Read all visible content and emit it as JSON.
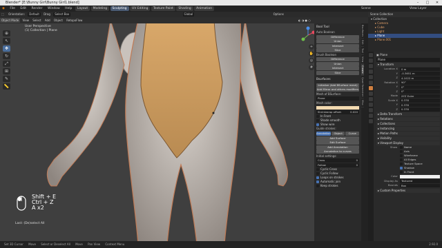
{
  "window": {
    "title": "Blender* [E:\\Bunny Girl\\Bunny Girl1.blend]"
  },
  "menubar": {
    "items": [
      "File",
      "Edit",
      "Render",
      "Window",
      "Help"
    ],
    "workspaces": [
      "Layout",
      "Modeling",
      "Sculpting",
      "UV Editing",
      "Texture Paint",
      "Shading",
      "Animation"
    ],
    "active_workspace": "Sculpting",
    "scene": "Scene",
    "view_layer": "View Layer"
  },
  "toolheader": {
    "orientation_label": "Orientation:",
    "orientation_value": "Default",
    "drag_label": "Drag",
    "drag_value": "Select Box",
    "global": "Global",
    "options": "Options"
  },
  "viewport_header": {
    "mode": "Object Mode",
    "view": "View",
    "select": "Select",
    "add": "Add",
    "object": "Object",
    "retopo": "RetopoFlow"
  },
  "viewport": {
    "perspective": "User Perspective",
    "collection_info": "(1) Collection | Plane"
  },
  "npanel": {
    "bool_tool": "Bool Tool",
    "auto_boolean": "Auto Boolean",
    "auto_buttons": [
      "Difference",
      "Union",
      "Intersect",
      "Slice"
    ],
    "brush_boolean": "Brush Boolean",
    "brush_buttons": [
      "Difference",
      "Union",
      "Intersect",
      "Slice"
    ],
    "bsurfaces": "Bsurfaces",
    "initialize": "Initialize (Add BSurface mesh)",
    "add_mirror": "Add Mirror and others modifiers",
    "mesh_label": "Mesh of BSurface:",
    "mesh_value": "Plane",
    "mesh_color": "Mesh color:",
    "shrinkwrap_label": "Shrinkwrap offset:",
    "shrinkwrap_value": "0.020",
    "in_front": "In Front",
    "shade_smooth": "Shade smooth",
    "show_wire": "Show wire",
    "guide_strokes": "Guide strokes:",
    "guide_tabs": [
      "Annotation",
      "Object",
      "Curve"
    ],
    "add_surface": "Add Surface",
    "edit_surface": "Edit Surface",
    "add_annotation": "Add Annotation",
    "annotation_to_curves": "Annotation to curves",
    "initial_settings": "Initial settings:",
    "cross_label": "Cross",
    "cross_value": "0",
    "follow_label": "Follow",
    "follow_value": "0",
    "cyclic_cross": "Cyclic Cross",
    "cyclic_follow": "Cyclic Follow",
    "loops_on_strokes": "Loops on strokes",
    "automatic_join": "Automatic join",
    "keep_strokes": "Keep strokes",
    "tabs": [
      "Bsurfaces",
      "Edit",
      "Tool",
      "View",
      "Create",
      "Quad Remesher",
      "Misc"
    ]
  },
  "outliner": {
    "title": "Scene Collection",
    "rows": [
      {
        "label": "Collection"
      },
      {
        "label": "Camera"
      },
      {
        "label": "Cube"
      },
      {
        "label": "Light"
      },
      {
        "label": "Plane"
      },
      {
        "label": "Plane.001"
      }
    ]
  },
  "properties": {
    "object_name": "Plane",
    "data_name": "Plane",
    "transform": "Transform",
    "location_label": "Location X",
    "loc": [
      "0 m",
      "-0.3651 m",
      "4.1022 m"
    ],
    "rotation_label": "Rotation X",
    "rot": [
      "90°",
      "0°",
      "0°"
    ],
    "mode_label": "Mode",
    "mode_value": "XYZ Euler",
    "scale_label": "Scale X",
    "scale": [
      "0.378",
      "0.378",
      "0.378"
    ],
    "sections": [
      "Delta Transform",
      "Relations",
      "Collections",
      "Instancing",
      "Motion Paths",
      "Visibility",
      "Viewport Display"
    ],
    "show_label": "Show",
    "show_items": [
      "Name",
      "Axis",
      "Wireframe",
      "All Edges",
      "Texture Space",
      "Shadow",
      "In Front"
    ],
    "color_label": "Color",
    "display_as_label": "Display As",
    "display_as_value": "Textured",
    "bounds_label": "Bounds",
    "bounds_value": "Box",
    "custom_properties": "Custom Properties"
  },
  "shortcut_overlay": {
    "line1": "Shift + E",
    "line2": "Ctrl + Z",
    "line3": "A x2"
  },
  "last_op": "Last: (De)select All",
  "statusbar": {
    "items": [
      "Set 3D Cursor",
      "Move",
      "Select or Deselect All",
      "Move",
      "Pan View",
      "Context Menu"
    ],
    "version": "2.92.0"
  }
}
